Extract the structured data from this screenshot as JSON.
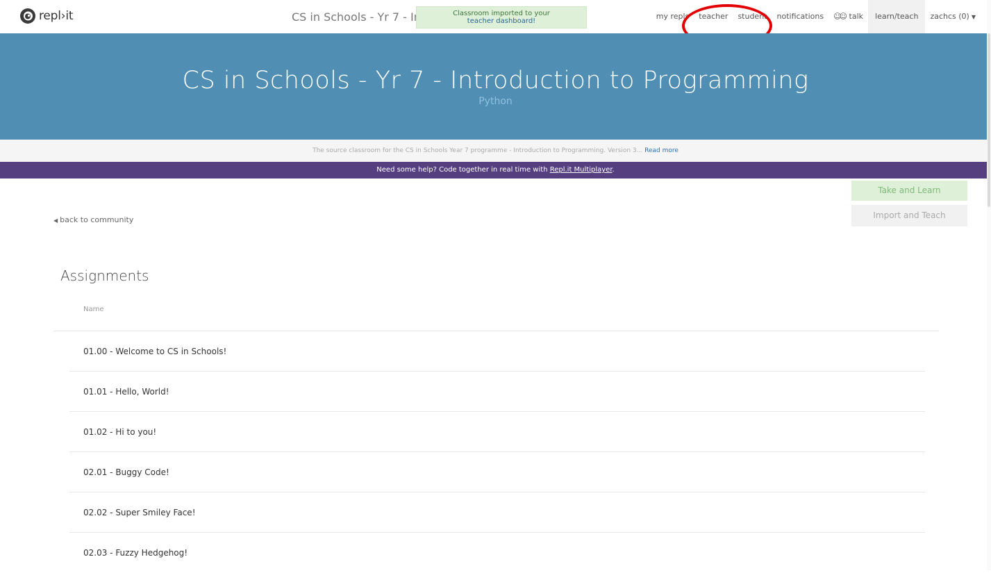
{
  "nav": {
    "logo_text": "repl›it",
    "page_title": "CS in Schools - Yr 7 - Introduction to Programming",
    "links": {
      "my_repls": "my repls",
      "teacher": "teacher",
      "student": "student",
      "notifications": "notifications",
      "talk": "talk",
      "learn_teach": "learn/teach",
      "user": "zachcs (0)"
    }
  },
  "toast": {
    "line1": "Classroom imported to your",
    "line2": "teacher dashboard!"
  },
  "hero": {
    "title": "CS in Schools - Yr 7 - Introduction to Programming",
    "language": "Python"
  },
  "description": {
    "text": "The source classroom for the CS in Schools Year 7 programme - Introduction to Programming. Version 3...",
    "read_more": "Read more"
  },
  "banner": {
    "text": "Need some help? Code together in real time with",
    "link": "Repl.it Multiplayer",
    "suffix": "."
  },
  "actions": {
    "take_and_learn": "Take and Learn",
    "import_and_teach": "Import and Teach"
  },
  "back_link": "back to community",
  "assignments": {
    "heading": "Assignments",
    "column_name": "Name",
    "items": [
      "01.00 - Welcome to CS in Schools!",
      "01.01 - Hello, World!",
      "01.02 - Hi to you!",
      "02.01 - Buggy Code!",
      "02.02 - Super Smiley Face!",
      "02.03 - Fuzzy Hedgehog!"
    ]
  },
  "colors": {
    "hero_bg": "#508fb3",
    "banner_bg": "#553f7f",
    "toast_bg": "#dff0d8",
    "annotation_circle": "#e20000"
  }
}
